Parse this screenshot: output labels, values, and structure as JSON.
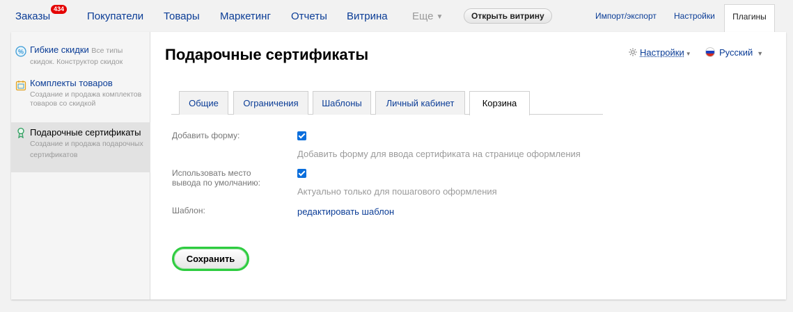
{
  "topnav": {
    "orders": {
      "label": "Заказы",
      "badge": "434"
    },
    "items": [
      {
        "label": "Покупатели"
      },
      {
        "label": "Товары"
      },
      {
        "label": "Маркетинг"
      },
      {
        "label": "Отчеты"
      },
      {
        "label": "Витрина"
      },
      {
        "label": "Еще"
      }
    ],
    "open_store": "Открыть витрину",
    "import_export": "Импорт/экспорт",
    "settings": "Настройки",
    "plugins": "Плагины"
  },
  "sidebar": {
    "items": [
      {
        "title": "Гибкие скидки",
        "desc": "Все типы скидок. Конструктор скидок",
        "icon": "percent-icon"
      },
      {
        "title": "Комплекты товаров",
        "desc": "Создание и продажа комплектов товаров со скидкой",
        "icon": "bundle-icon"
      },
      {
        "title": "Подарочные сертификаты",
        "desc": "Создание и продажа подарочных сертификатов",
        "icon": "certificate-icon",
        "active": true
      }
    ]
  },
  "page": {
    "title": "Подарочные сертификаты",
    "settings_link": "Настройки",
    "language": "Русский"
  },
  "tabs": [
    {
      "label": "Общие"
    },
    {
      "label": "Ограничения"
    },
    {
      "label": "Шаблоны"
    },
    {
      "label": "Личный кабинет"
    },
    {
      "label": "Корзина",
      "active": true
    }
  ],
  "form": {
    "add_form": {
      "label": "Добавить форму:",
      "checked": true,
      "hint": "Добавить форму для ввода сертификата на странице оформления"
    },
    "default_place": {
      "label": "Использовать место вывода по умолчанию:",
      "checked": true,
      "hint": "Актуально только для пошагового оформления"
    },
    "template": {
      "label": "Шаблон:",
      "link": "редактировать шаблон"
    },
    "save": "Сохранить"
  },
  "colors": {
    "link": "#0a3c96",
    "badge": "#e40000",
    "save_border": "#2ecc40",
    "checkbox": "#0a6edc"
  }
}
